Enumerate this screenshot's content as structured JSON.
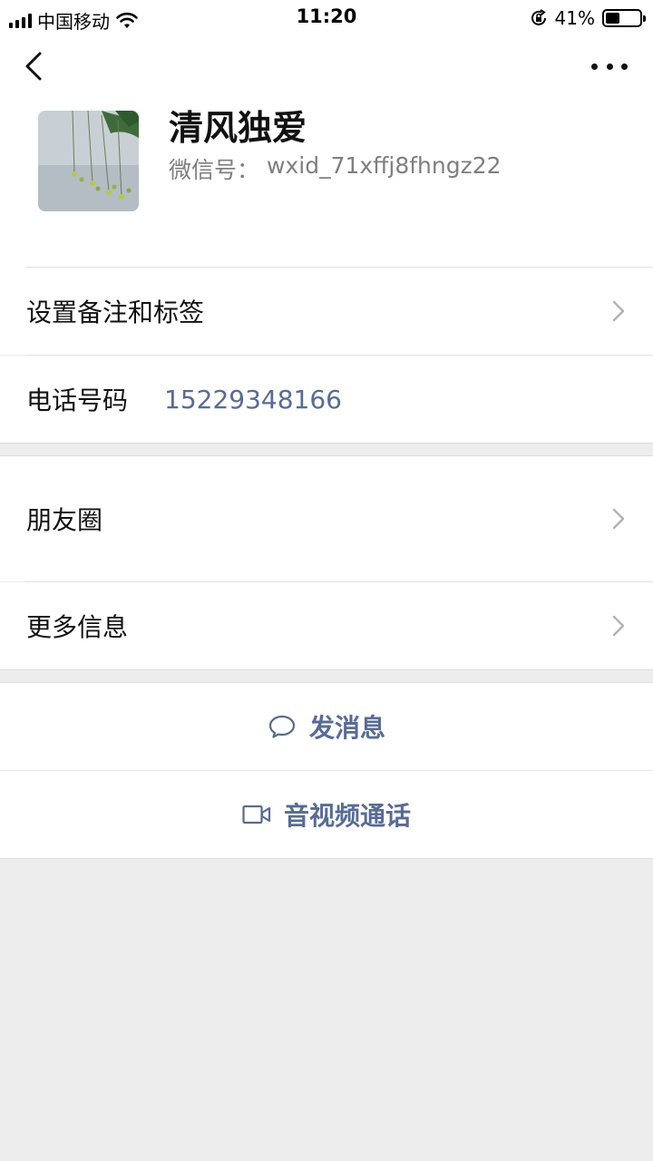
{
  "status_bar": {
    "carrier": "中国移动",
    "time": "11:20",
    "battery_percent": "41%",
    "battery_level": 0.41
  },
  "profile": {
    "nickname": "清风独爱",
    "wxid_label": "微信号：",
    "wxid_value": "wxid_71xffj8fhngz22"
  },
  "cells": {
    "remark_tags": "设置备注和标签",
    "phone_label": "电话号码",
    "phone_value": "15229348166",
    "moments": "朋友圈",
    "more_info": "更多信息"
  },
  "actions": {
    "send_message": "发消息",
    "video_call": "音视频通话"
  },
  "colors": {
    "link_blue": "#576b95",
    "background": "#ededed"
  },
  "icons": [
    "back-arrow-icon",
    "more-dots-icon",
    "chevron-right-icon",
    "chat-bubble-icon",
    "video-camera-icon",
    "wifi-icon",
    "orientation-lock-icon",
    "battery-icon",
    "signal-icon"
  ]
}
